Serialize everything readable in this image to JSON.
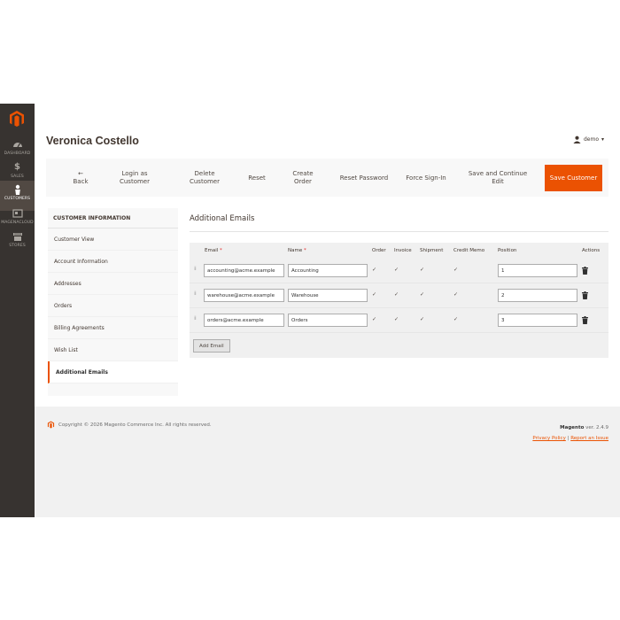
{
  "sidebar": {
    "items": [
      {
        "label": "DASHBOARD",
        "icon": "dashboard-gauge-icon"
      },
      {
        "label": "SALES",
        "icon": "dollar-icon",
        "glyph": "$"
      },
      {
        "label": "CUSTOMERS",
        "icon": "customer-person-icon"
      },
      {
        "label": "MAGENACLOUD",
        "icon": "cloud-icon"
      },
      {
        "label": "STORES",
        "icon": "store-icon"
      }
    ],
    "active": "CUSTOMERS"
  },
  "header": {
    "title": "Veronica Costello",
    "user": "demo",
    "user_caret": "▾"
  },
  "actions": {
    "back": "Back",
    "back_arrow": "←",
    "login_as_customer": "Login as Customer",
    "delete_customer": "Delete Customer",
    "reset": "Reset",
    "create_order": "Create Order",
    "reset_password": "Reset Password",
    "force_sign_in": "Force Sign-In",
    "save_continue": "Save and Continue Edit",
    "save_customer": "Save Customer"
  },
  "panel": {
    "heading": "CUSTOMER INFORMATION",
    "tabs": [
      "Customer View",
      "Account Information",
      "Addresses",
      "Orders",
      "Billing Agreements",
      "Wish List",
      "Additional Emails"
    ],
    "active_tab": "Additional Emails"
  },
  "section": {
    "title": "Additional Emails"
  },
  "grid": {
    "columns": {
      "email": "Email",
      "name": "Name",
      "order": "Order",
      "invoice": "Invoice",
      "shipment": "Shipment",
      "credit_memo": "Credit Memo",
      "position": "Position",
      "actions": "Actions",
      "required_mark": "*"
    },
    "rows": [
      {
        "email": "accounting@acme.example",
        "name": "Accounting",
        "position": "1"
      },
      {
        "email": "warehouse@acme.example",
        "name": "Warehouse",
        "position": "2"
      },
      {
        "email": "orders@acme.example",
        "name": "Orders",
        "position": "3"
      }
    ],
    "checkmark": "✓",
    "handle_glyph": "⁞⁞",
    "add_button": "Add Email"
  },
  "footer": {
    "copyright": "Copyright © 2026 Magento Commerce Inc. All rights reserved.",
    "brand": "Magento",
    "version": " ver. 2.4.9",
    "privacy": "Privacy Policy",
    "separator": " | ",
    "report": "Report an Issue"
  },
  "colors": {
    "sidebar_bg": "#373330",
    "accent": "#eb5202",
    "panel_bg": "#f8f8f8"
  }
}
